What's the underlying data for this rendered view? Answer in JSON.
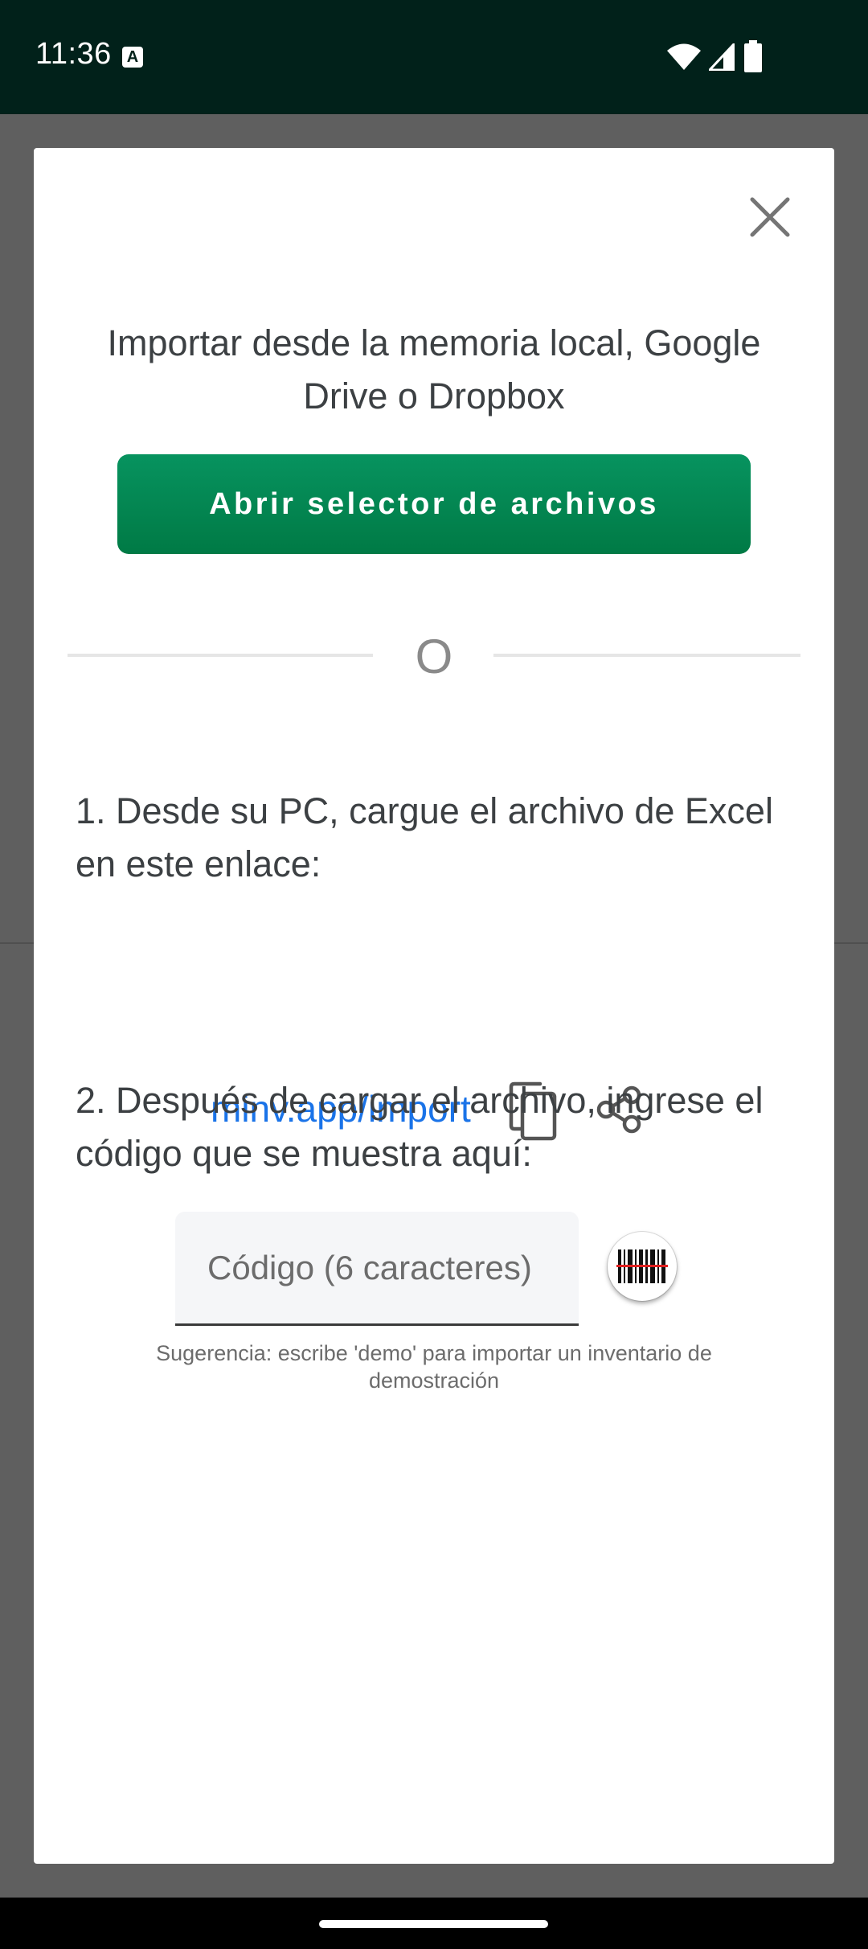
{
  "status_bar": {
    "time": "11:36",
    "notification_icon": "A",
    "icons": [
      "wifi-icon",
      "cell-signal-icon",
      "battery-icon"
    ]
  },
  "dialog": {
    "close_icon": "close-icon",
    "heading": "Importar desde la memoria local, Google Drive o Dropbox",
    "open_picker_label": "Abrir selector de archivos",
    "or_separator": "O",
    "step1_text": "1. Desde su PC, cargue el archivo de Excel en este enlace:",
    "import_link": "minv.app/import",
    "copy_icon": "copy-icon",
    "share_icon": "share-icon",
    "step2_text": "2. Después de cargar el archivo, ingrese el código que se muestra aquí:",
    "code_placeholder": "Código (6 caracteres)",
    "code_value": "",
    "barcode_icon": "barcode-scanner-icon",
    "hint": "Sugerencia: escribe 'demo' para importar un inventario de demostración"
  },
  "colors": {
    "status_bar_bg": "#01211a",
    "primary_button": "#07935f",
    "link": "#1a73e8",
    "text": "#3c4043",
    "scrim": "#5f5f5f"
  }
}
